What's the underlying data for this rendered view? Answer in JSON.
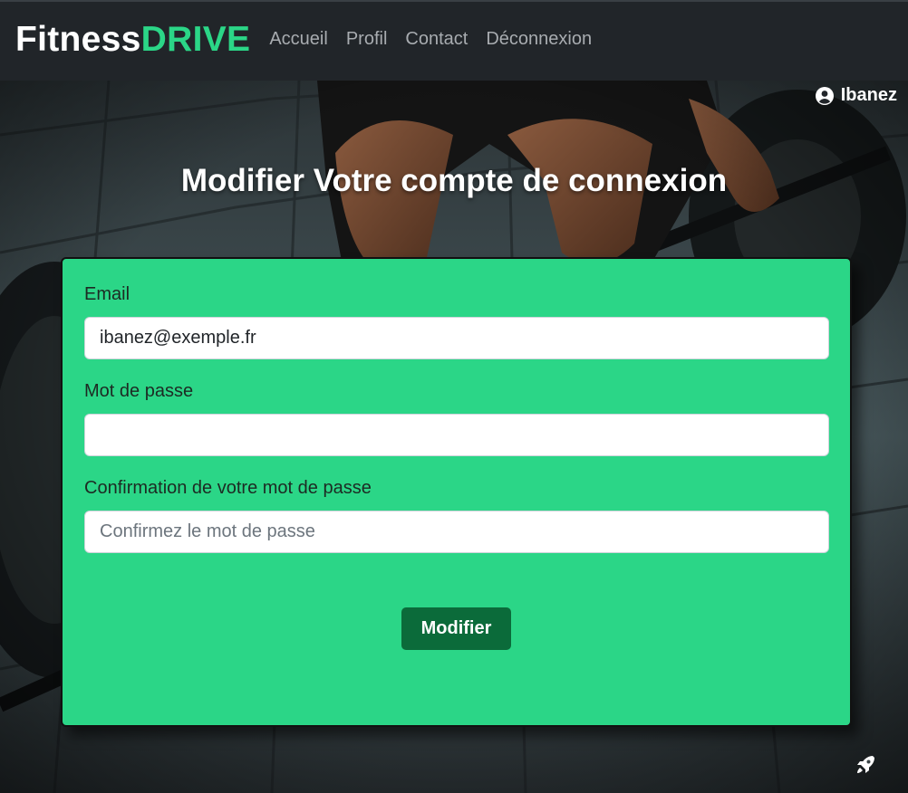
{
  "navbar": {
    "brand_part1": "Fitness",
    "brand_part2": "DRIVE",
    "links": [
      "Accueil",
      "Profil",
      "Contact",
      "Déconnexion"
    ]
  },
  "user": {
    "name": "Ibanez",
    "icon": "user-circle-icon"
  },
  "page": {
    "title": "Modifier Votre compte de connexion"
  },
  "form": {
    "email_label": "Email",
    "email_value": "ibanez@exemple.fr",
    "password_label": "Mot de passe",
    "password_value": "",
    "confirm_label": "Confirmation de votre mot de passe",
    "confirm_placeholder": "Confirmez le mot de passe",
    "submit_label": "Modifier"
  },
  "footer": {
    "icon": "rocket-icon"
  },
  "colors": {
    "accent": "#2bd687",
    "button": "#0b6b3a",
    "navbar": "#212529"
  }
}
